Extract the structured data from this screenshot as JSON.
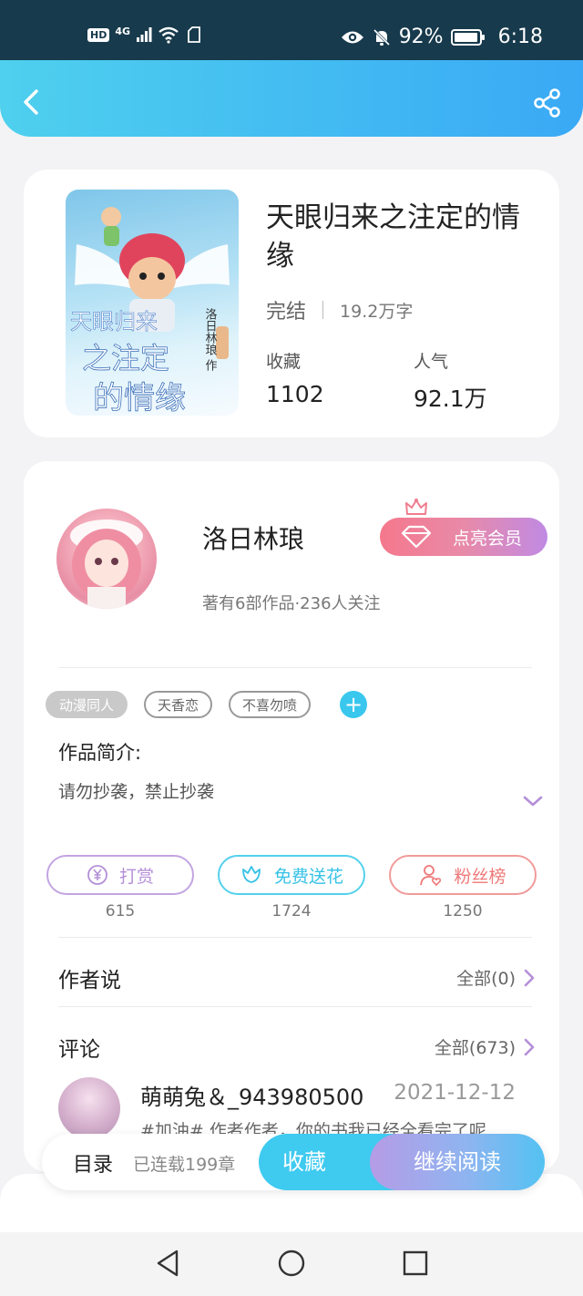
{
  "status_bar": {
    "hd": "HD",
    "network": "4G",
    "battery": "92%",
    "time": "6:18"
  },
  "book": {
    "title": "天眼归来之注定的情缘",
    "status": "完结",
    "words": "19.2万字",
    "collect_label": "收藏",
    "collect_count": "1102",
    "popularity_label": "人气",
    "popularity_count": "92.1万",
    "cover_title_line1": "天眼归来",
    "cover_title_line2": "之注定",
    "cover_title_line3": "的情缘",
    "cover_author": "洛日林琅 作"
  },
  "author": {
    "name": "洛日林琅",
    "vip_label": "点亮会员",
    "stats": "著有6部作品·236人关注"
  },
  "tags": [
    "动漫同人",
    "天香恋",
    "不喜勿喷"
  ],
  "intro": {
    "heading": "作品简介:",
    "text": "请勿抄袭，禁止抄袭"
  },
  "actions": [
    {
      "label": "打赏",
      "count": "615",
      "color": "#b48fd8"
    },
    {
      "label": "免费送花",
      "count": "1724",
      "color": "#3fc9e8"
    },
    {
      "label": "粉丝榜",
      "count": "1250",
      "color": "#f07d7d"
    }
  ],
  "author_says": {
    "title": "作者说",
    "link": "全部(0)"
  },
  "comments": {
    "title": "评论",
    "link": "全部(673)",
    "first": {
      "user": "萌萌兔＆_943980500",
      "date": "2021-12-12",
      "text": "#加油# 作者作者，你的书我已经全看完了呢"
    }
  },
  "bottom_bar": {
    "toc": "目录",
    "serial": "已连载199章",
    "favorite": "收藏",
    "read": "继续阅读"
  },
  "colors": {
    "accent": "#3fcaf0",
    "status_bar": "#173a4c"
  }
}
